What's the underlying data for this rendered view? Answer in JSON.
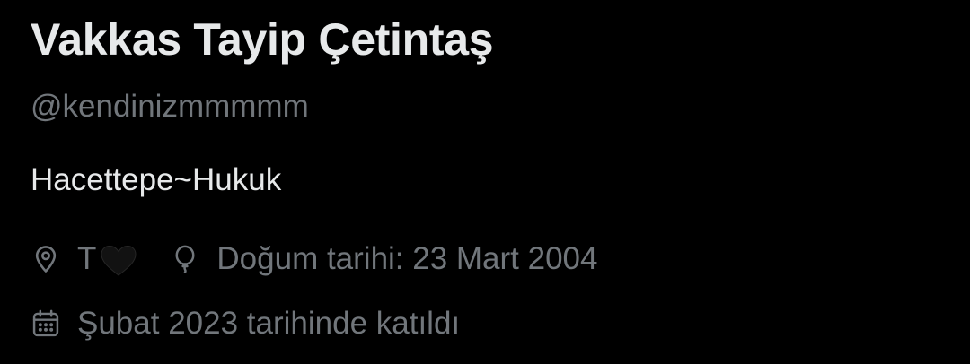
{
  "profile": {
    "display_name": "Vakkas Tayip Çetintaş",
    "handle": "@kendinizmmmmm",
    "bio": "Hacettepe~Hukuk",
    "location": {
      "text": "T",
      "emoji": "black-heart",
      "icon": "location-pin-icon"
    },
    "birthday": {
      "text": "Doğum tarihi: 23 Mart 2004",
      "icon": "balloon-icon"
    },
    "joined": {
      "text": "Şubat 2023 tarihinde katıldı",
      "icon": "calendar-icon"
    }
  },
  "colors": {
    "background": "#000000",
    "primary_text": "#e7e9ea",
    "secondary_text": "#71767b",
    "heart": "#111111"
  }
}
